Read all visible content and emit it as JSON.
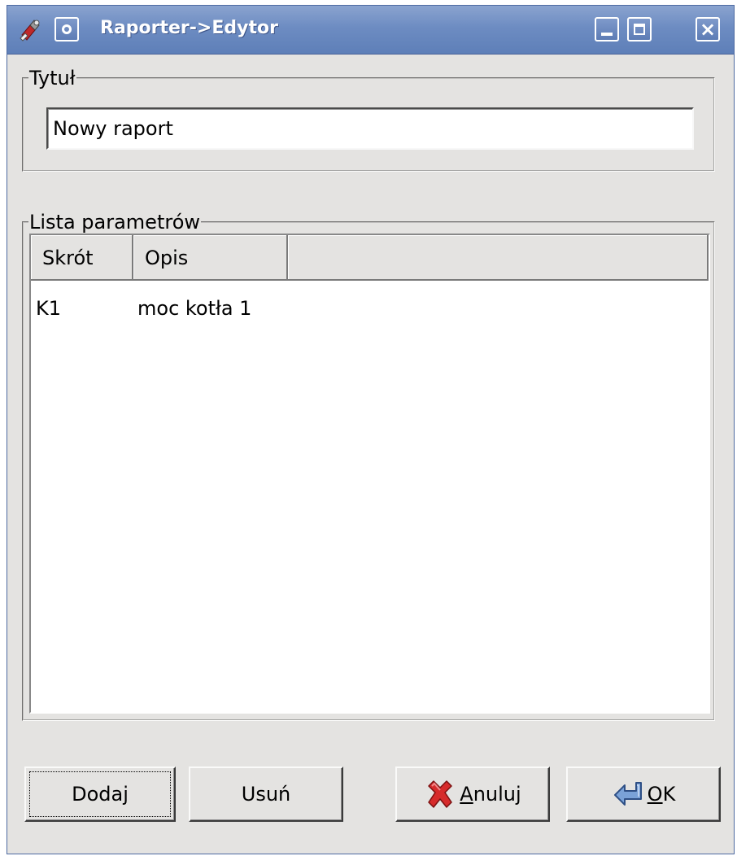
{
  "window": {
    "title": "Raporter->Edytor",
    "close_glyph": "×"
  },
  "title_group": {
    "legend": "Tytuł",
    "input_value": "Nowy raport"
  },
  "params_group": {
    "legend": "Lista parametrów",
    "columns": [
      "Skrót",
      "Opis"
    ],
    "rows": [
      {
        "skrot": "K1",
        "opis": "moc kotła 1"
      }
    ]
  },
  "buttons": {
    "dodaj": "Dodaj",
    "usun": "Usuń",
    "anuluj_mnemonic": "A",
    "anuluj_rest": "nuluj",
    "ok_mnemonic": "O",
    "ok_rest": "K"
  },
  "icons": {
    "app": "app-icon",
    "menu": "window-menu-icon",
    "cancel": "red-x-icon",
    "ok": "enter-arrow-icon"
  },
  "colors": {
    "titlebar": "#6d8cc2",
    "window_bg": "#e4e3e1",
    "cancel_icon": "#d62b2b",
    "ok_icon": "#7aa2d8"
  }
}
